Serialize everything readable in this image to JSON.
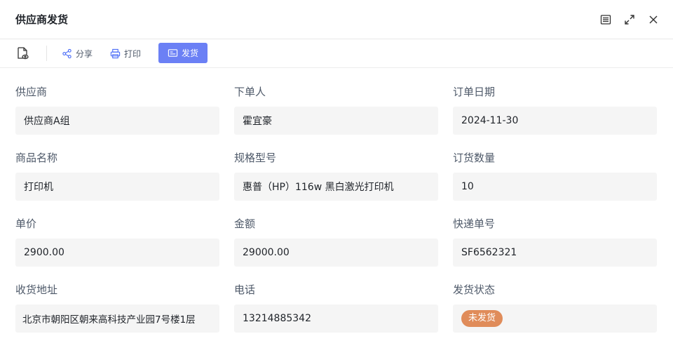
{
  "window": {
    "title": "供应商发货",
    "icons": [
      "list-icon",
      "expand-icon",
      "close-icon"
    ]
  },
  "toolbar": {
    "view_icon": "document-eye-icon",
    "share_label": "分享",
    "print_label": "打印",
    "ship_label": "发货",
    "accent": "#6b80f5"
  },
  "form": {
    "supplier": {
      "label": "供应商",
      "value": "供应商A组"
    },
    "orderer": {
      "label": "下单人",
      "value": "霍宜豪"
    },
    "order_date": {
      "label": "订单日期",
      "value": "2024-11-30"
    },
    "product_name": {
      "label": "商品名称",
      "value": "打印机"
    },
    "spec": {
      "label": "规格型号",
      "value": "惠普（HP）116w 黑白激光打印机"
    },
    "quantity": {
      "label": "订货数量",
      "value": "10"
    },
    "unit_price": {
      "label": "单价",
      "value": "2900.00"
    },
    "amount": {
      "label": "金额",
      "value": "29000.00"
    },
    "tracking": {
      "label": "快递单号",
      "value": "SF6562321"
    },
    "address": {
      "label": "收货地址",
      "value": "北京市朝阳区朝来高科技产业园7号楼1层"
    },
    "phone": {
      "label": "电话",
      "value": "13214885342"
    },
    "status": {
      "label": "发货状态",
      "value": "未发货",
      "color": "#e08c5a"
    }
  }
}
